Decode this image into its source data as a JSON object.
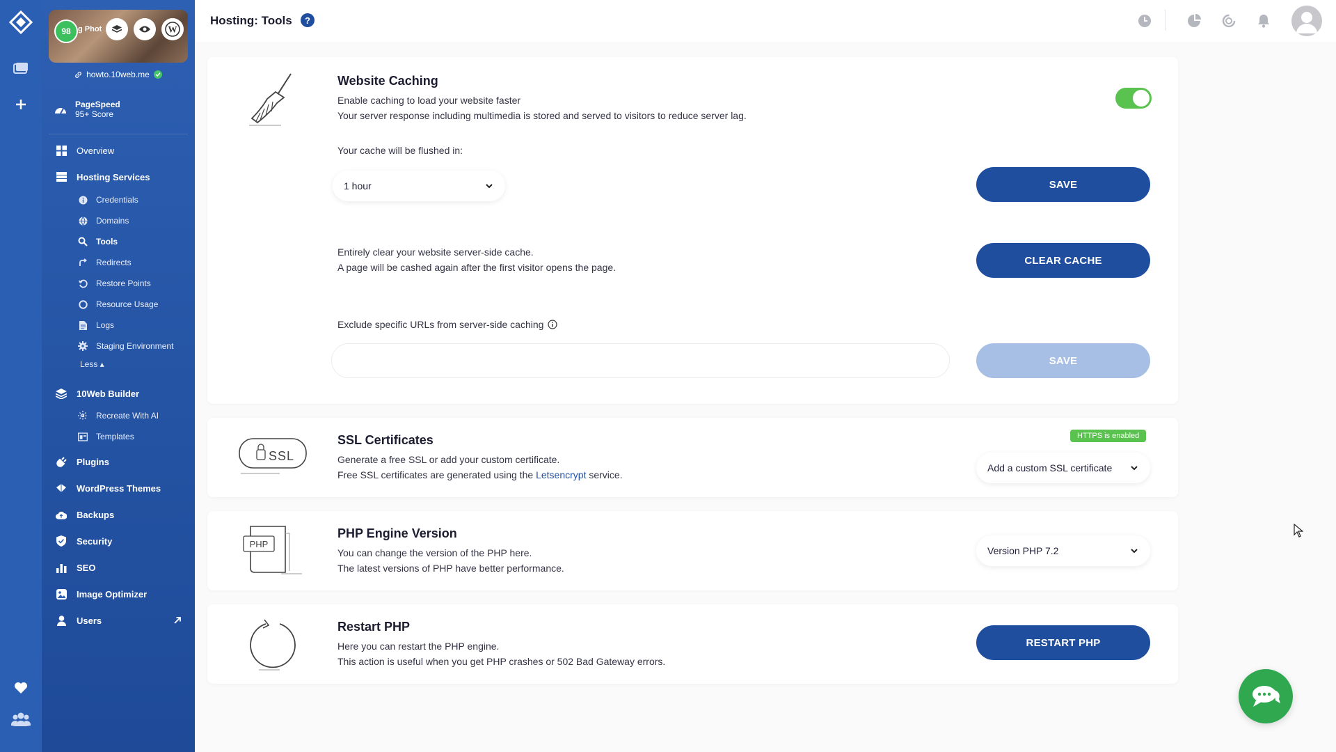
{
  "header": {
    "title": "Hosting: Tools",
    "help_icon": "?"
  },
  "site": {
    "score": "98",
    "card_text": "g Phot",
    "domain": "howto.10web.me"
  },
  "pagespeed": {
    "title": "PageSpeed",
    "subtitle": "95+ Score"
  },
  "nav": {
    "overview": "Overview",
    "hosting_services": "Hosting Services",
    "sub": {
      "credentials": "Credentials",
      "domains": "Domains",
      "tools": "Tools",
      "redirects": "Redirects",
      "restore_points": "Restore Points",
      "resource_usage": "Resource Usage",
      "logs": "Logs",
      "staging": "Staging Environment"
    },
    "less": "Less ▴",
    "builder": "10Web Builder",
    "builder_sub": {
      "recreate": "Recreate With AI",
      "templates": "Templates"
    },
    "plugins": "Plugins",
    "themes": "WordPress Themes",
    "backups": "Backups",
    "security": "Security",
    "seo": "SEO",
    "image_optimizer": "Image Optimizer",
    "users": "Users"
  },
  "caching": {
    "title": "Website Caching",
    "line1": "Enable caching to load your website faster",
    "line2": "Your server response including multimedia is stored and served to visitors to reduce server lag.",
    "flush_label": "Your cache will be flushed in:",
    "flush_value": "1 hour",
    "save_label": "SAVE",
    "clear_line1": "Entirely clear your website server-side cache.",
    "clear_line2": "A page will be cashed again after the first visitor opens the page.",
    "clear_label": "CLEAR CACHE",
    "exclude_label": "Exclude specific URLs from server-side caching",
    "exclude_placeholder": "",
    "save2_label": "SAVE",
    "toggle_on": true
  },
  "ssl": {
    "title": "SSL Certificates",
    "badge": "HTTPS is enabled",
    "line1": "Generate a free SSL or add your custom certificate.",
    "line2_pre": "Free SSL certificates are generated using the ",
    "line2_link": "Letsencrypt",
    "line2_post": " service.",
    "dropdown": "Add a custom SSL certificate",
    "icon_text": "SSL"
  },
  "php": {
    "title": "PHP Engine Version",
    "line1": "You can change the version of the PHP here.",
    "line2": "The latest versions of PHP have better performance.",
    "dropdown": "Version PHP 7.2",
    "icon_text": "PHP"
  },
  "restart": {
    "title": "Restart PHP",
    "line1": "Here you can restart the PHP engine.",
    "line2": "This action is useful when you get PHP crashes or 502 Bad Gateway errors.",
    "button": "RESTART PHP"
  },
  "colors": {
    "primary": "#1f4e9e",
    "sidebar": "#2a5fb3",
    "success": "#5ac24e",
    "chat": "#2fa84f"
  }
}
